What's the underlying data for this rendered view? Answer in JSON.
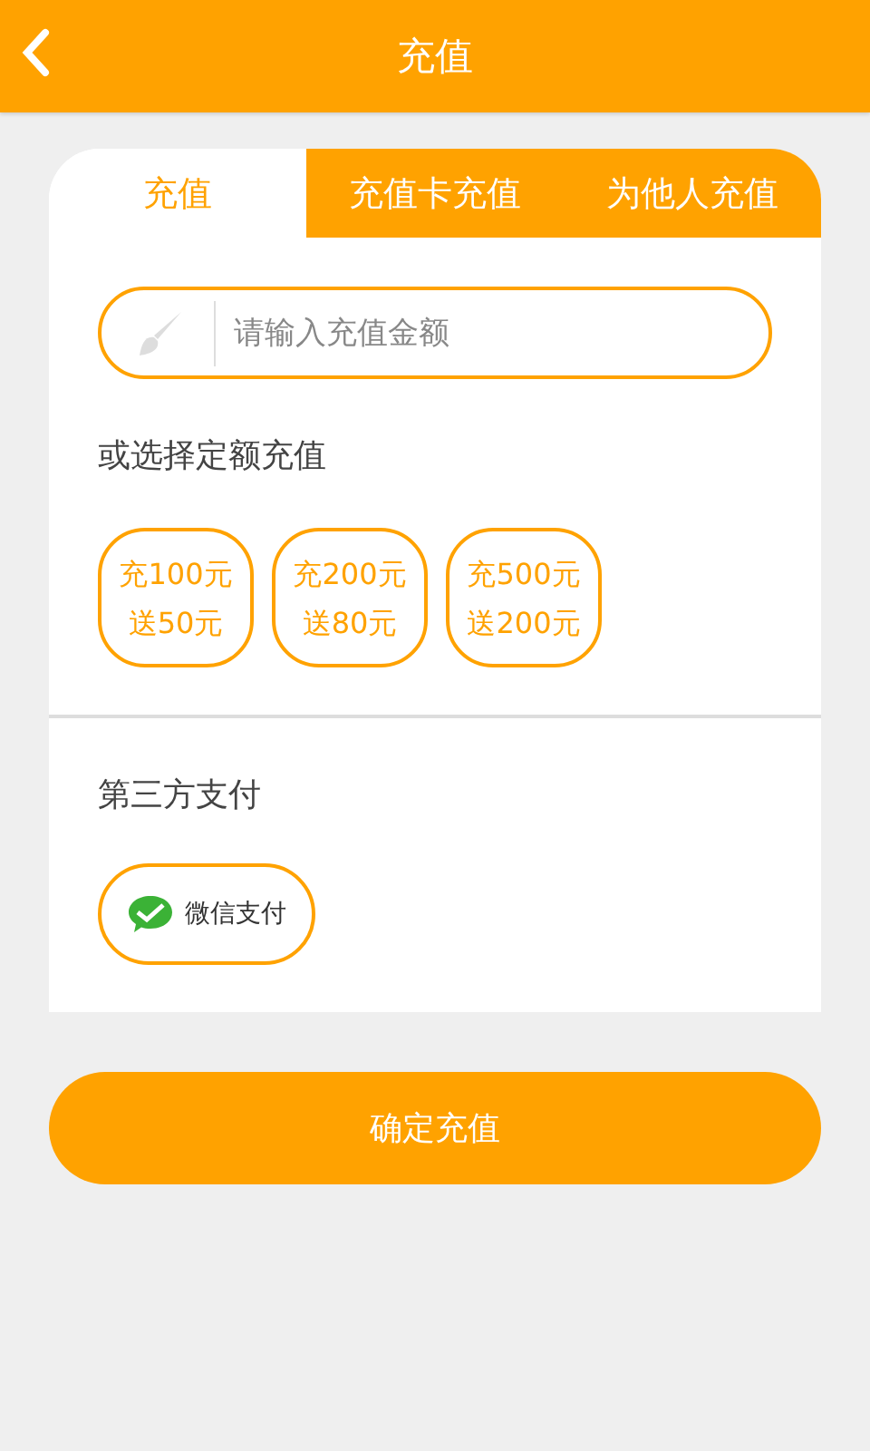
{
  "header": {
    "title": "充值"
  },
  "tabs": [
    {
      "label": "充值",
      "selected": true
    },
    {
      "label": "充值卡充值",
      "selected": false
    },
    {
      "label": "为他人充值",
      "selected": false
    }
  ],
  "amount_field": {
    "placeholder": "请输入充值金额"
  },
  "preset_label": "或选择定额充值",
  "presets": [
    {
      "line1": "充100元",
      "line2": "送50元"
    },
    {
      "line1": "充200元",
      "line2": "送80元"
    },
    {
      "line1": "充500元",
      "line2": "送200元"
    }
  ],
  "payment_label": "第三方支付",
  "payment_methods": [
    {
      "label": "微信支付"
    }
  ],
  "confirm_button": "确定充值"
}
